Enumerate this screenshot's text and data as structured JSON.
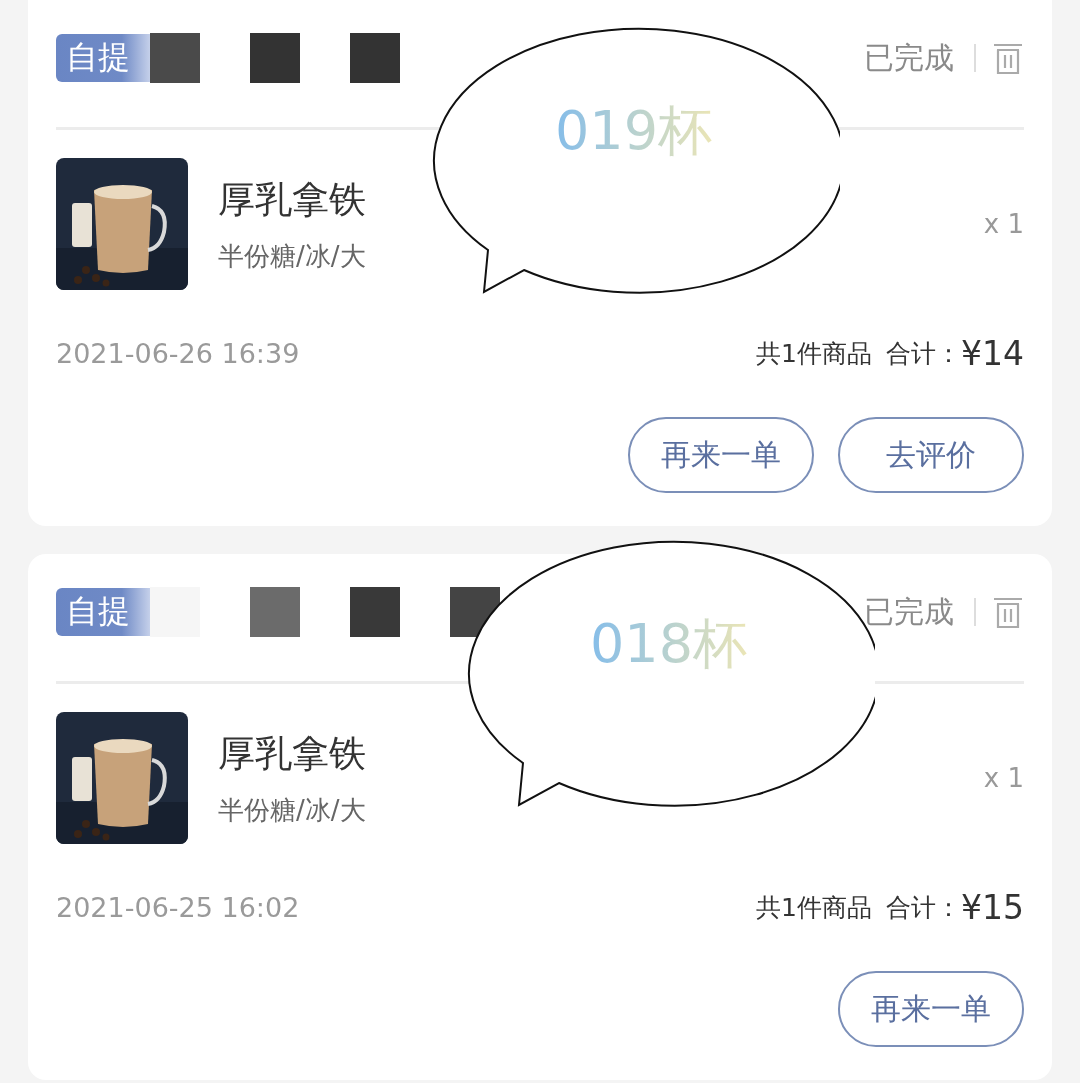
{
  "orders": [
    {
      "badge": "自提",
      "redaction_blocks": [
        {
          "color": "#4a4a4a"
        },
        {
          "color": "#333333"
        },
        {
          "color": "#333333"
        }
      ],
      "status": "已完成",
      "product": {
        "name": "厚乳拿铁",
        "options": "半份糖/冰/大",
        "quantity": "x 1"
      },
      "time": "2021-06-26 16:39",
      "item_count": "共1件商品",
      "total_label": "合计：",
      "total": "¥14",
      "buttons": [
        "再来一单",
        "去评价"
      ],
      "bubble": "019杯"
    },
    {
      "badge": "自提",
      "redaction_blocks": [
        {
          "color": "#f6f6f6"
        },
        {
          "color": "#6b6b6b"
        },
        {
          "color": "#393939"
        },
        {
          "color": "#444444"
        }
      ],
      "status": "已完成",
      "product": {
        "name": "厚乳拿铁",
        "options": "半份糖/冰/大",
        "quantity": "x 1"
      },
      "time": "2021-06-25 16:02",
      "item_count": "共1件商品",
      "total_label": "合计：",
      "total": "¥15",
      "buttons": [
        "再来一单"
      ],
      "bubble": "018杯"
    }
  ]
}
